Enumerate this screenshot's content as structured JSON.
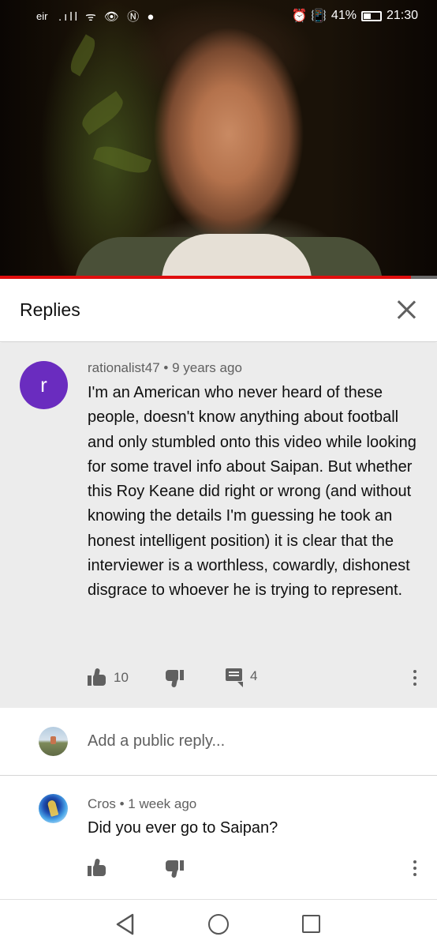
{
  "status_bar": {
    "carrier": "eir",
    "left_icons": "signal wifi eye nfc chat",
    "left_icons_glyphs": ".ıll ᯤ 👁 Ⓝ ●",
    "right_icons_glyphs": "⏰ 📳",
    "battery_percent": "41%",
    "time": "21:30"
  },
  "video": {
    "progress_fraction": 0.94,
    "progress_color": "#e10e0e"
  },
  "replies_panel": {
    "title": "Replies",
    "close_icon": "close-icon"
  },
  "main_comment": {
    "avatar_letter": "r",
    "avatar_color": "#6a2cbf",
    "meta": "rationalist47 • 9 years ago",
    "text": "I'm an American who never heard of these people, doesn't know anything about football and only stumbled onto this video while looking for some travel info about Saipan. But whether this Roy Keane did right or wrong (and without knowing the details I'm guessing he took an honest intelligent position) it is clear that the interviewer is a worthless, cowardly, dishonest disgrace to whoever he is trying to represent.",
    "like_count": "10",
    "reply_count": "4"
  },
  "add_reply": {
    "placeholder": "Add a public reply..."
  },
  "reply": {
    "meta": "Cros • 1 week ago",
    "text": "Did you ever go to Saipan?"
  },
  "nav_bar": {
    "back_icon": "back-triangle-icon",
    "home_icon": "home-circle-icon",
    "recents_icon": "recents-square-icon"
  }
}
